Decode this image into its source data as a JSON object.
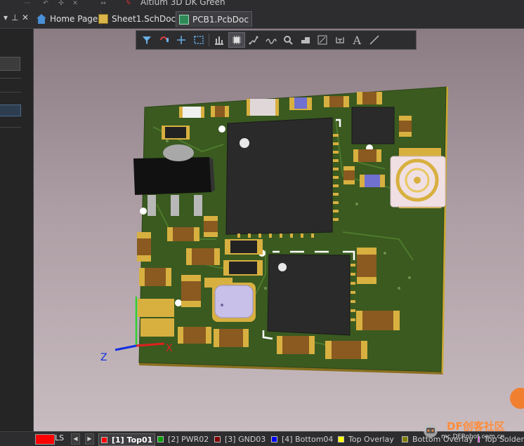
{
  "window": {
    "title": "Altium 3D DK Green"
  },
  "tabs": [
    {
      "label": "Home Page",
      "icon": "home-icon"
    },
    {
      "label": "Sheet1.SchDoc *",
      "icon": "schematic-doc-icon"
    },
    {
      "label": "PCB1.PcbDoc",
      "icon": "pcb-doc-icon",
      "active": true
    }
  ],
  "toolbar": {
    "tools": [
      "filter-icon",
      "interactive-routing-icon",
      "crosshair-icon",
      "select-area-icon",
      "align-icon",
      "place-component-icon",
      "route-net-icon",
      "differential-pair-icon",
      "place-via-icon",
      "place-polygon-icon",
      "dimension-icon",
      "place-text-box-icon",
      "place-string-icon",
      "place-line-icon"
    ],
    "string_glyph": "A"
  },
  "axes": {
    "z": "Z",
    "x": "X"
  },
  "layerbar": {
    "ls": "LS",
    "layers": [
      {
        "label": "[1] Top01",
        "color": "#ff0000",
        "active": true
      },
      {
        "label": "[2] PWR02",
        "color": "#00a000"
      },
      {
        "label": "[3] GND03",
        "color": "#800000"
      },
      {
        "label": "[4] Bottom04",
        "color": "#0000ff"
      },
      {
        "label": "Top Overlay",
        "color": "#ffff00"
      },
      {
        "label": "Bottom Overlay",
        "color": "#808000"
      },
      {
        "label": "Top Solder",
        "color": "#ff00ff"
      }
    ],
    "current_layer_color": "#ff0000"
  },
  "watermark": {
    "text": "DF创客社区",
    "subtext": "mc.DFRobot.com.cn"
  },
  "colors": {
    "board": "#3a5a20",
    "pad": "#d8b040",
    "chip": "#2a2a2a"
  }
}
